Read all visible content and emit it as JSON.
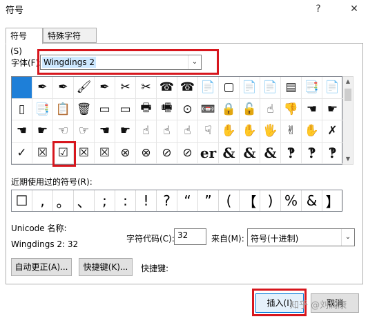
{
  "window": {
    "title": "符号",
    "help_label": "?",
    "close_label": "✕"
  },
  "tabs": [
    {
      "label": "符号(S)"
    },
    {
      "label": "特殊字符(P)"
    }
  ],
  "font": {
    "label": "字体(F):",
    "value": "Wingdings 2"
  },
  "symbol_grid": {
    "rows": [
      [
        "",
        "✒",
        "✒",
        "🖌",
        "✒",
        "✂",
        "✂",
        "☎",
        "☎",
        "📄",
        "▢",
        "📄",
        "📄",
        "▤",
        "📑",
        "📄"
      ],
      [
        "▯",
        "📑",
        "📋",
        "🗑",
        "▭",
        "▭",
        "🖶",
        "🖷",
        "⊙",
        "📼",
        "🔒",
        "🔓",
        "☝",
        "👎",
        "☚",
        "☛"
      ],
      [
        "☚",
        "☛",
        "☜",
        "☞",
        "☚",
        "☛",
        "☝",
        "☝",
        "☝",
        "☟",
        "✋",
        "✋",
        "🖐",
        "✌",
        "✋",
        "✗"
      ],
      [
        "✓",
        "☒",
        "☑",
        "☒",
        "☒",
        "⊗",
        "⊗",
        "⊘",
        "⊘",
        "er",
        "&",
        "&",
        "&",
        "‽",
        "‽",
        "‽"
      ]
    ]
  },
  "recent": {
    "label": "近期使用过的符号(R):",
    "symbols": [
      "☐",
      ",",
      "。",
      "、",
      ";",
      ":",
      "!",
      "?",
      "“",
      "”",
      "(",
      "【",
      ")",
      "%",
      "&",
      "】"
    ]
  },
  "unicode_name_label": "Unicode 名称:",
  "char_name": "Wingdings 2: 32",
  "char_code": {
    "label": "字符代码(C):",
    "value": "32"
  },
  "from": {
    "label": "来自(M):",
    "value": "符号(十进制)"
  },
  "buttons": {
    "autocorrect": "自动更正(A)...",
    "shortcut_key": "快捷键(K)...",
    "shortcut_label": "快捷键:",
    "insert": "插入(I)",
    "cancel": "取消"
  },
  "watermark": "知乎 @刘润康"
}
